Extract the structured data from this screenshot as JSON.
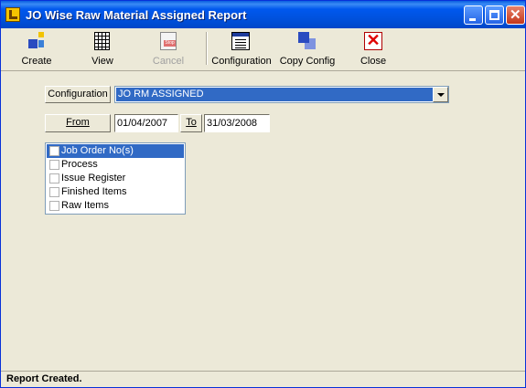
{
  "window": {
    "title": "JO Wise Raw Material Assigned Report"
  },
  "toolbar": {
    "buttons": [
      {
        "label": "Create",
        "icon": "create-icon"
      },
      {
        "label": "View",
        "icon": "view-grid-icon"
      },
      {
        "label": "Cancel",
        "icon": "stop-icon",
        "disabled": true
      },
      {
        "label": "Configuration",
        "icon": "configuration-icon"
      },
      {
        "label": "Copy Config",
        "icon": "copy-config-icon"
      },
      {
        "label": "Close",
        "icon": "close-x-icon"
      }
    ]
  },
  "form": {
    "configuration_label": "Configuration",
    "configuration_value": "JO RM ASSIGNED",
    "from_label": "From",
    "from_date": "01/04/2007",
    "to_label": "To",
    "to_date": "31/03/2008"
  },
  "options": [
    {
      "label": "Job Order No(s)",
      "checked": false,
      "selected": true
    },
    {
      "label": "Process",
      "checked": false,
      "selected": false
    },
    {
      "label": "Issue Register",
      "checked": false,
      "selected": false
    },
    {
      "label": "Finished Items",
      "checked": false,
      "selected": false
    },
    {
      "label": "Raw Items",
      "checked": false,
      "selected": false
    }
  ],
  "status": {
    "text": "Report Created."
  },
  "colors": {
    "titlebar": "#0054E3",
    "selection": "#316AC5",
    "face": "#ECE9D8"
  }
}
